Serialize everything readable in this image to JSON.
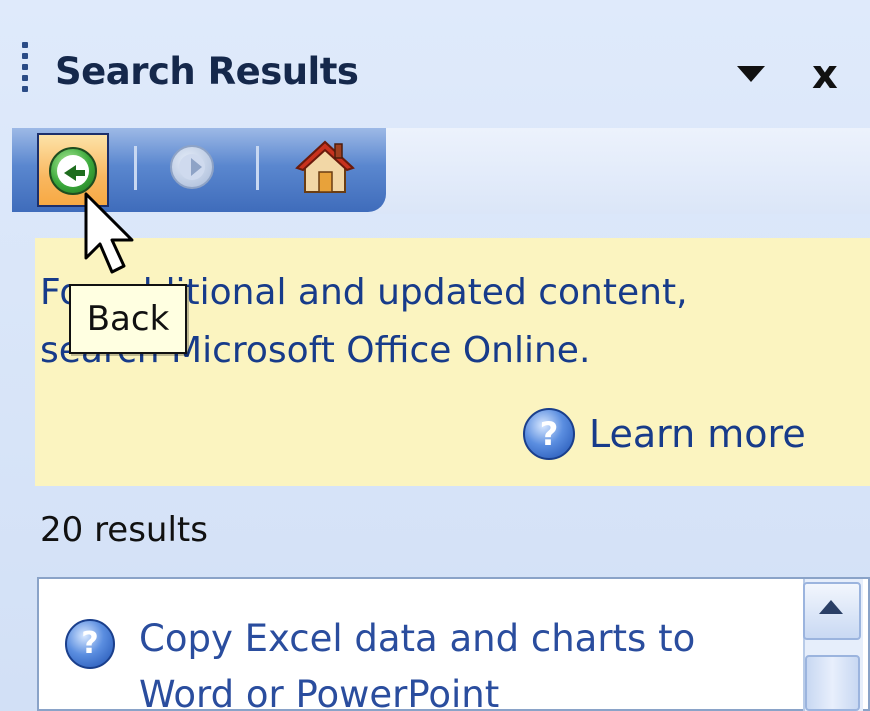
{
  "pane": {
    "title": "Search Results",
    "dropdown_icon": "triangle-down-icon",
    "close_label": "x"
  },
  "toolbar": {
    "back_icon": "back-arrow-icon",
    "forward_icon": "forward-arrow-icon",
    "home_icon": "home-icon",
    "back_tooltip": "Back"
  },
  "info_box": {
    "line1": "For additional and updated content,",
    "line2": "search Microsoft Office Online.",
    "learn_more_label": "Learn more",
    "help_icon_glyph": "?"
  },
  "results": {
    "count_label": "20 results",
    "items": [
      {
        "title": "Copy Excel data and charts to Word or PowerPoint",
        "icon_glyph": "?"
      }
    ]
  },
  "colors": {
    "title_text": "#15284b",
    "link_text": "#173b8a",
    "info_background": "#fbf4c0",
    "toolbar_blue": "#3f6cbb",
    "back_button_highlight": "#f9b760"
  }
}
